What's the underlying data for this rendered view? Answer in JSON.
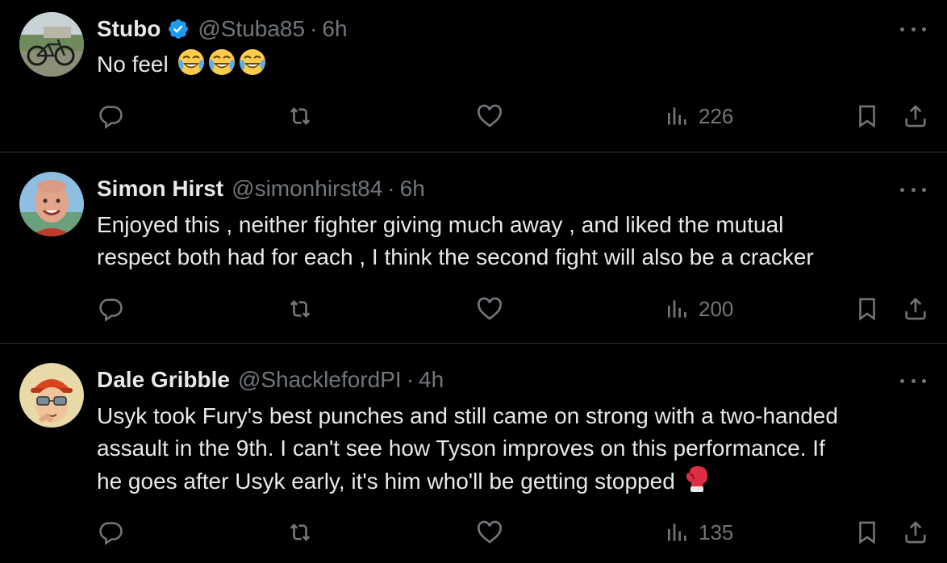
{
  "tweets": [
    {
      "name": "Stubo",
      "verified": true,
      "handle": "@Stuba85",
      "separator": "·",
      "time": "6h",
      "text": "No feel",
      "emoji": [
        "face-with-tears-of-joy",
        "face-with-tears-of-joy",
        "face-with-tears-of-joy"
      ],
      "views": "226"
    },
    {
      "name": "Simon Hirst",
      "verified": false,
      "handle": "@simonhirst84",
      "separator": "·",
      "time": "6h",
      "text_lines": [
        "Enjoyed this , neither fighter giving much away , and liked the mutual",
        "respect both had for each , I think the second fight will also be a cracker"
      ],
      "views": "200"
    },
    {
      "name": "Dale Gribble",
      "verified": false,
      "handle": "@ShacklefordPI",
      "separator": "·",
      "time": "4h",
      "text_lines": [
        "Usyk took Fury's best punches and still came on strong with a two-handed",
        "assault in the 9th. I can't see how Tyson improves on this performance. If",
        "he goes after Usyk early, it's him who'll be getting stopped"
      ],
      "emoji": [
        "boxing-glove"
      ],
      "views": "135"
    }
  ],
  "colors": {
    "background": "#000000",
    "text": "#e7e9ea",
    "secondary": "#71767b",
    "divider": "#2f3336",
    "verified": "#1d9bf0"
  }
}
